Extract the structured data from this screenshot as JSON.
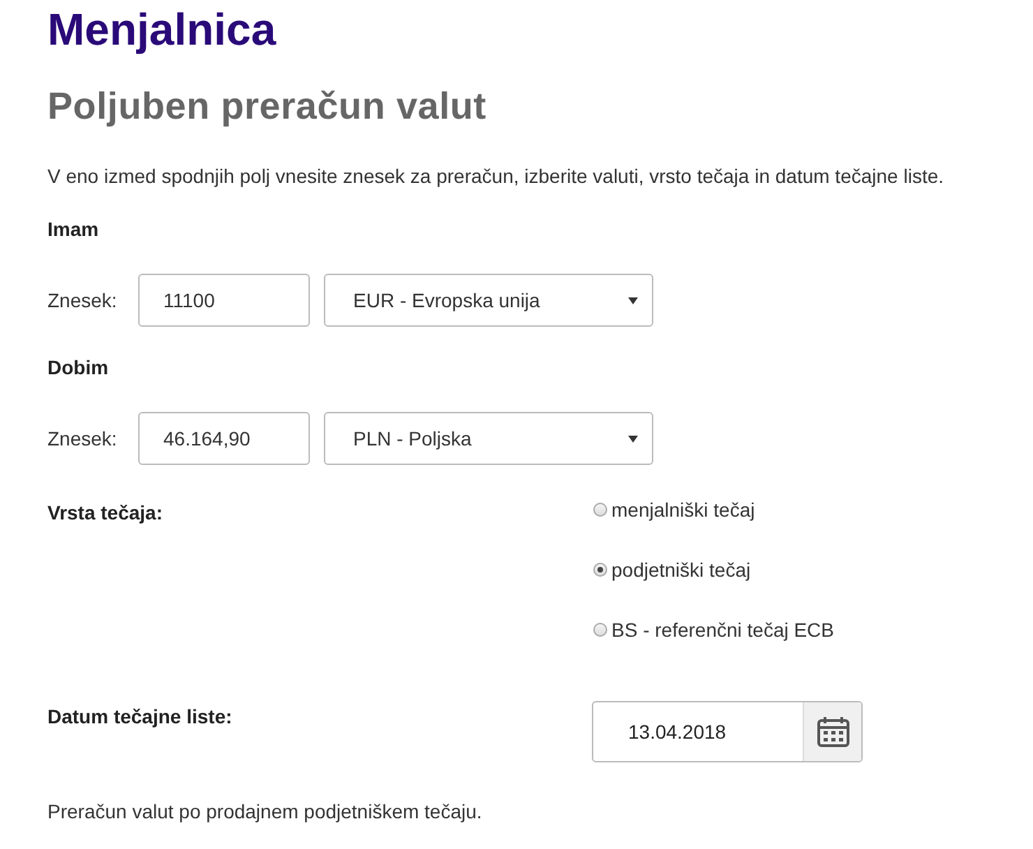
{
  "site_title": "Menjalnica",
  "heading": "Poljuben preračun valut",
  "intro": "V eno izmed spodnjih polj vnesite znesek za preračun, izberite valuti, vrsto tečaja in datum tečajne liste.",
  "sections": [
    {
      "title": "Imam",
      "amount_label": "Znesek:",
      "amount": "11100",
      "currency": "EUR - Evropska unija"
    },
    {
      "title": "Dobim",
      "amount_label": "Znesek:",
      "amount": "46.164,90",
      "currency": "PLN - Poljska"
    }
  ],
  "rate_type": {
    "label": "Vrsta tečaja:",
    "options": [
      {
        "label": "menjalniški tečaj",
        "selected": false
      },
      {
        "label": "podjetniški tečaj",
        "selected": true
      },
      {
        "label": "BS - referenčni tečaj ECB",
        "selected": false
      }
    ]
  },
  "date": {
    "label": "Datum tečajne liste:",
    "value": "13.04.2018"
  },
  "note": "Preračun valut po prodajnem podjetniškem tečaju."
}
